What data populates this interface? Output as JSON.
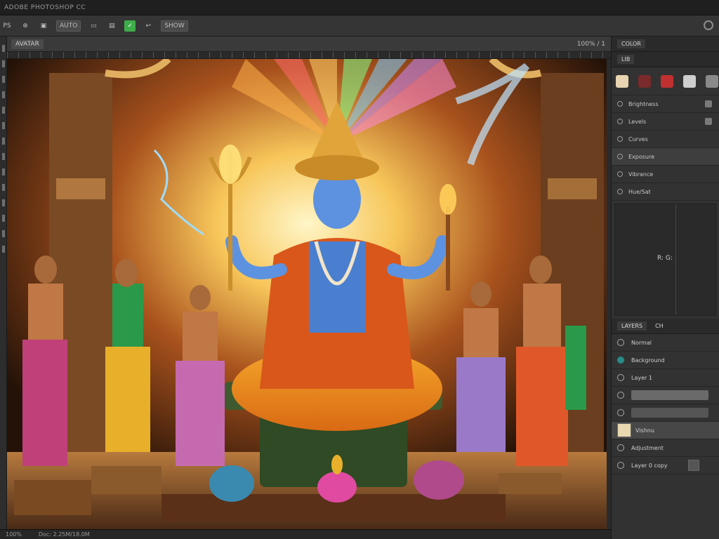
{
  "app": {
    "title": "ADOBE PHOTOSHOP CC"
  },
  "options_bar": {
    "items": [
      "PS",
      "⊕",
      "▣",
      "AUTO",
      "▭",
      "▤",
      "✓",
      "↩",
      "SHOW"
    ],
    "selected_index": 6
  },
  "document": {
    "tab_label": "AVATAR",
    "zoom": "100% / 1"
  },
  "statusbar": {
    "left": "100%",
    "doc": "Doc: 2.25M/18.0M"
  },
  "panel": {
    "tabs": [
      "COLOR",
      "LIB"
    ],
    "adjust_rows": [
      "Brightness",
      "Levels",
      "Curves",
      "Exposure",
      "Vibrance",
      "Hue/Sat"
    ],
    "info_label": "R: G:",
    "layers_tabs": [
      "LAYERS",
      "CH"
    ],
    "layers": [
      {
        "name": "Normal",
        "type": "text"
      },
      {
        "name": "Background",
        "type": "text"
      },
      {
        "name": "Layer 1",
        "type": "text"
      },
      {
        "name": "",
        "type": "bar"
      },
      {
        "name": "",
        "type": "bar"
      },
      {
        "name": "Vishnu",
        "type": "thumb",
        "selected": true
      },
      {
        "name": "Adjustment",
        "type": "text"
      },
      {
        "name": "Layer 0 copy",
        "type": "text"
      }
    ]
  },
  "colors": {
    "accent_green": "#3fae4a",
    "panel_bg": "#323232"
  }
}
